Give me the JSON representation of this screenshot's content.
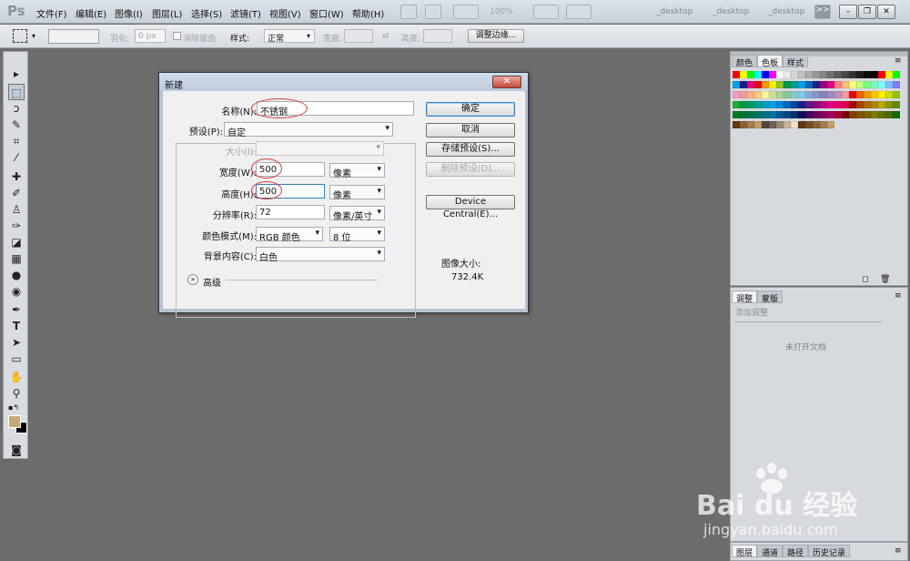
{
  "app": {
    "logo": "Ps"
  },
  "menu": [
    "文件(F)",
    "编辑(E)",
    "图像(I)",
    "图层(L)",
    "选择(S)",
    "滤镜(T)",
    "视图(V)",
    "窗口(W)",
    "帮助(H)"
  ],
  "menubar_extras": {
    "zoom": "100%",
    "doc_tabs": [
      "_desktop",
      "_desktop",
      "_desktop"
    ],
    "chevron": ">>"
  },
  "options": {
    "feather_label": "羽化:",
    "feather_value": "0 px",
    "antialias_label": "消除锯齿",
    "style_label": "样式:",
    "style_value": "正常",
    "width_label": "宽度:",
    "height_label": "高度:",
    "refine_button": "调整边缘..."
  },
  "dialog": {
    "title": "新建",
    "name_label": "名称(N):",
    "name_value": "不锈钢",
    "preset_label": "预设(P):",
    "preset_value": "自定",
    "size_label": "大小(I):",
    "width_label": "宽度(W):",
    "width_value": "500",
    "width_unit": "像素",
    "height_label": "高度(H):",
    "height_value": "500",
    "height_unit": "像素",
    "resolution_label": "分辨率(R):",
    "resolution_value": "72",
    "resolution_unit": "像素/英寸",
    "colormode_label": "颜色模式(M):",
    "colormode_value": "RGB 颜色",
    "bitdepth_value": "8 位",
    "bg_label": "背景内容(C):",
    "bg_value": "白色",
    "advanced_label": "高级",
    "buttons": {
      "ok": "确定",
      "cancel": "取消",
      "save_preset": "存储预设(S)...",
      "delete_preset": "删除预设(D)...",
      "device_central": "Device Central(E)..."
    },
    "image_size_label": "图像大小:",
    "image_size_value": "732.4K"
  },
  "panel_swatches": {
    "tabs": [
      "颜色",
      "色板",
      "样式"
    ]
  },
  "panel_adjust": {
    "tabs": [
      "调整",
      "蒙版"
    ],
    "header": "添加调整",
    "empty_text": "未打开文档"
  },
  "panel_layers": {
    "tabs": [
      "图层",
      "通道",
      "路径",
      "历史记录"
    ]
  },
  "watermark": {
    "brand": "Bai du 经验",
    "url": "jingyan.baidu.com"
  },
  "colors": {
    "foreground": "#c8a878",
    "background": "#000000",
    "canvas": "#6c6c6c"
  }
}
